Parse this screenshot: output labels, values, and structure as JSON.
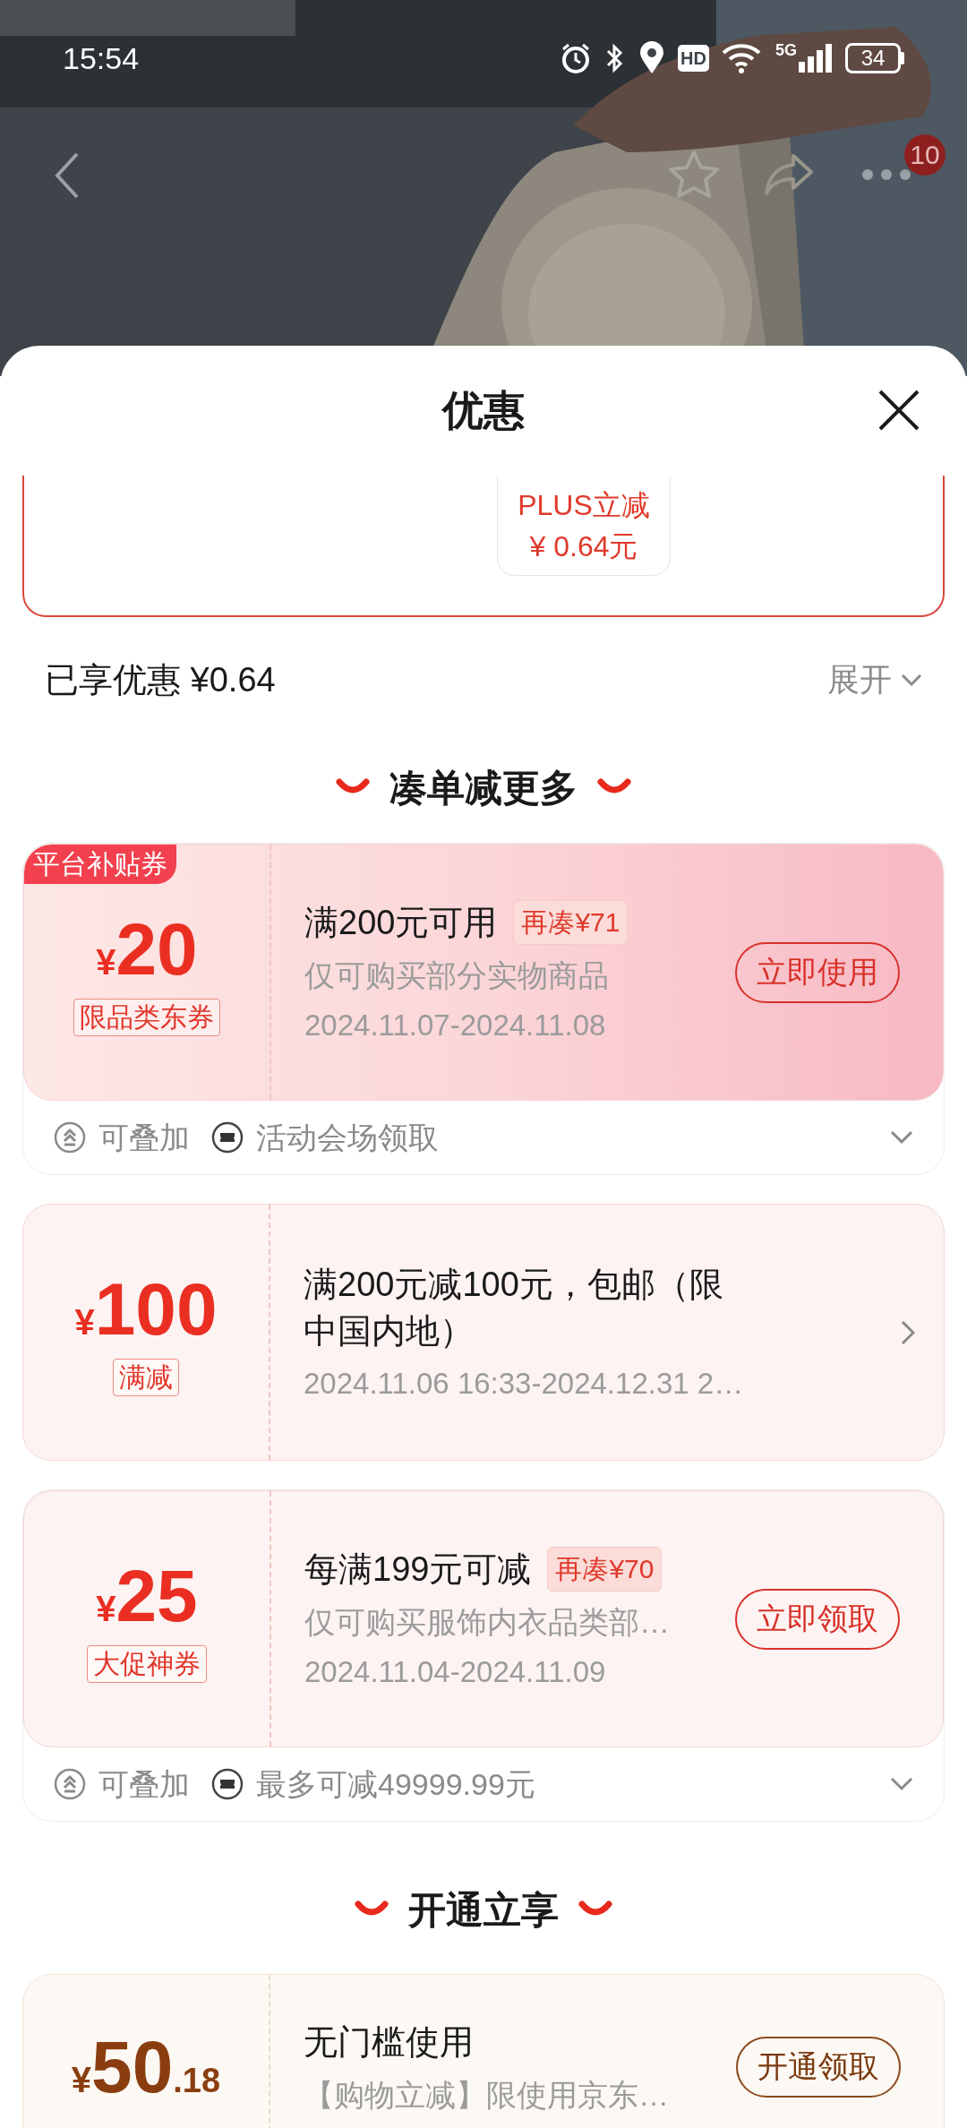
{
  "status_bar": {
    "time": "15:54",
    "hd_label": "HD",
    "network": "5G",
    "battery": "34"
  },
  "nav": {
    "badge": "10"
  },
  "sheet": {
    "title": "优惠",
    "previous_card": {
      "chip_lines": [
        "PLUS立减",
        "¥ 0.64元"
      ]
    },
    "summary": {
      "label": "已享优惠 ¥0.64",
      "toggle": "展开"
    },
    "sections": [
      {
        "heading": "凑单减更多",
        "coupons": [
          {
            "kind": "gradient",
            "corner_badge": "平台补贴券",
            "currency": "¥",
            "amount": "20",
            "tag": "限品类东券",
            "title": "满200元可用",
            "extra": "再凑¥71",
            "subtitle": "仅可购买部分实物商品",
            "dates": "2024.11.07-2024.11.08",
            "action": {
              "kind": "button",
              "label": "立即使用"
            },
            "footer": [
              {
                "kind": "stack",
                "text": "可叠加"
              },
              {
                "kind": "ticket",
                "text": "活动会场领取"
              }
            ]
          },
          {
            "kind": "pink",
            "currency": "¥",
            "amount": "100",
            "tag": "满减",
            "title": "满200元减100元，包邮（限中国内地）",
            "dates": "2024.11.06 16:33-2024.12.31 2…",
            "action": {
              "kind": "arrow"
            }
          },
          {
            "kind": "pink",
            "currency": "¥",
            "amount": "25",
            "tag": "大促神券",
            "title": "每满199元可减",
            "extra": "再凑¥70",
            "subtitle": "仅可购买服饰内衣品类部…",
            "dates": "2024.11.04-2024.11.09",
            "action": {
              "kind": "button",
              "label": "立即领取"
            },
            "footer": [
              {
                "kind": "stack",
                "text": "可叠加"
              },
              {
                "kind": "ticket",
                "text": "最多可减49999.99元"
              }
            ]
          }
        ]
      },
      {
        "heading": "开通立享",
        "coupons": [
          {
            "kind": "gold",
            "currency": "¥",
            "amount": "50",
            "decimals": ".18",
            "title": "无门槛使用",
            "subtitle": "【购物立减】限使用京东…",
            "action": {
              "kind": "button",
              "label": "开通领取"
            }
          }
        ]
      }
    ]
  }
}
